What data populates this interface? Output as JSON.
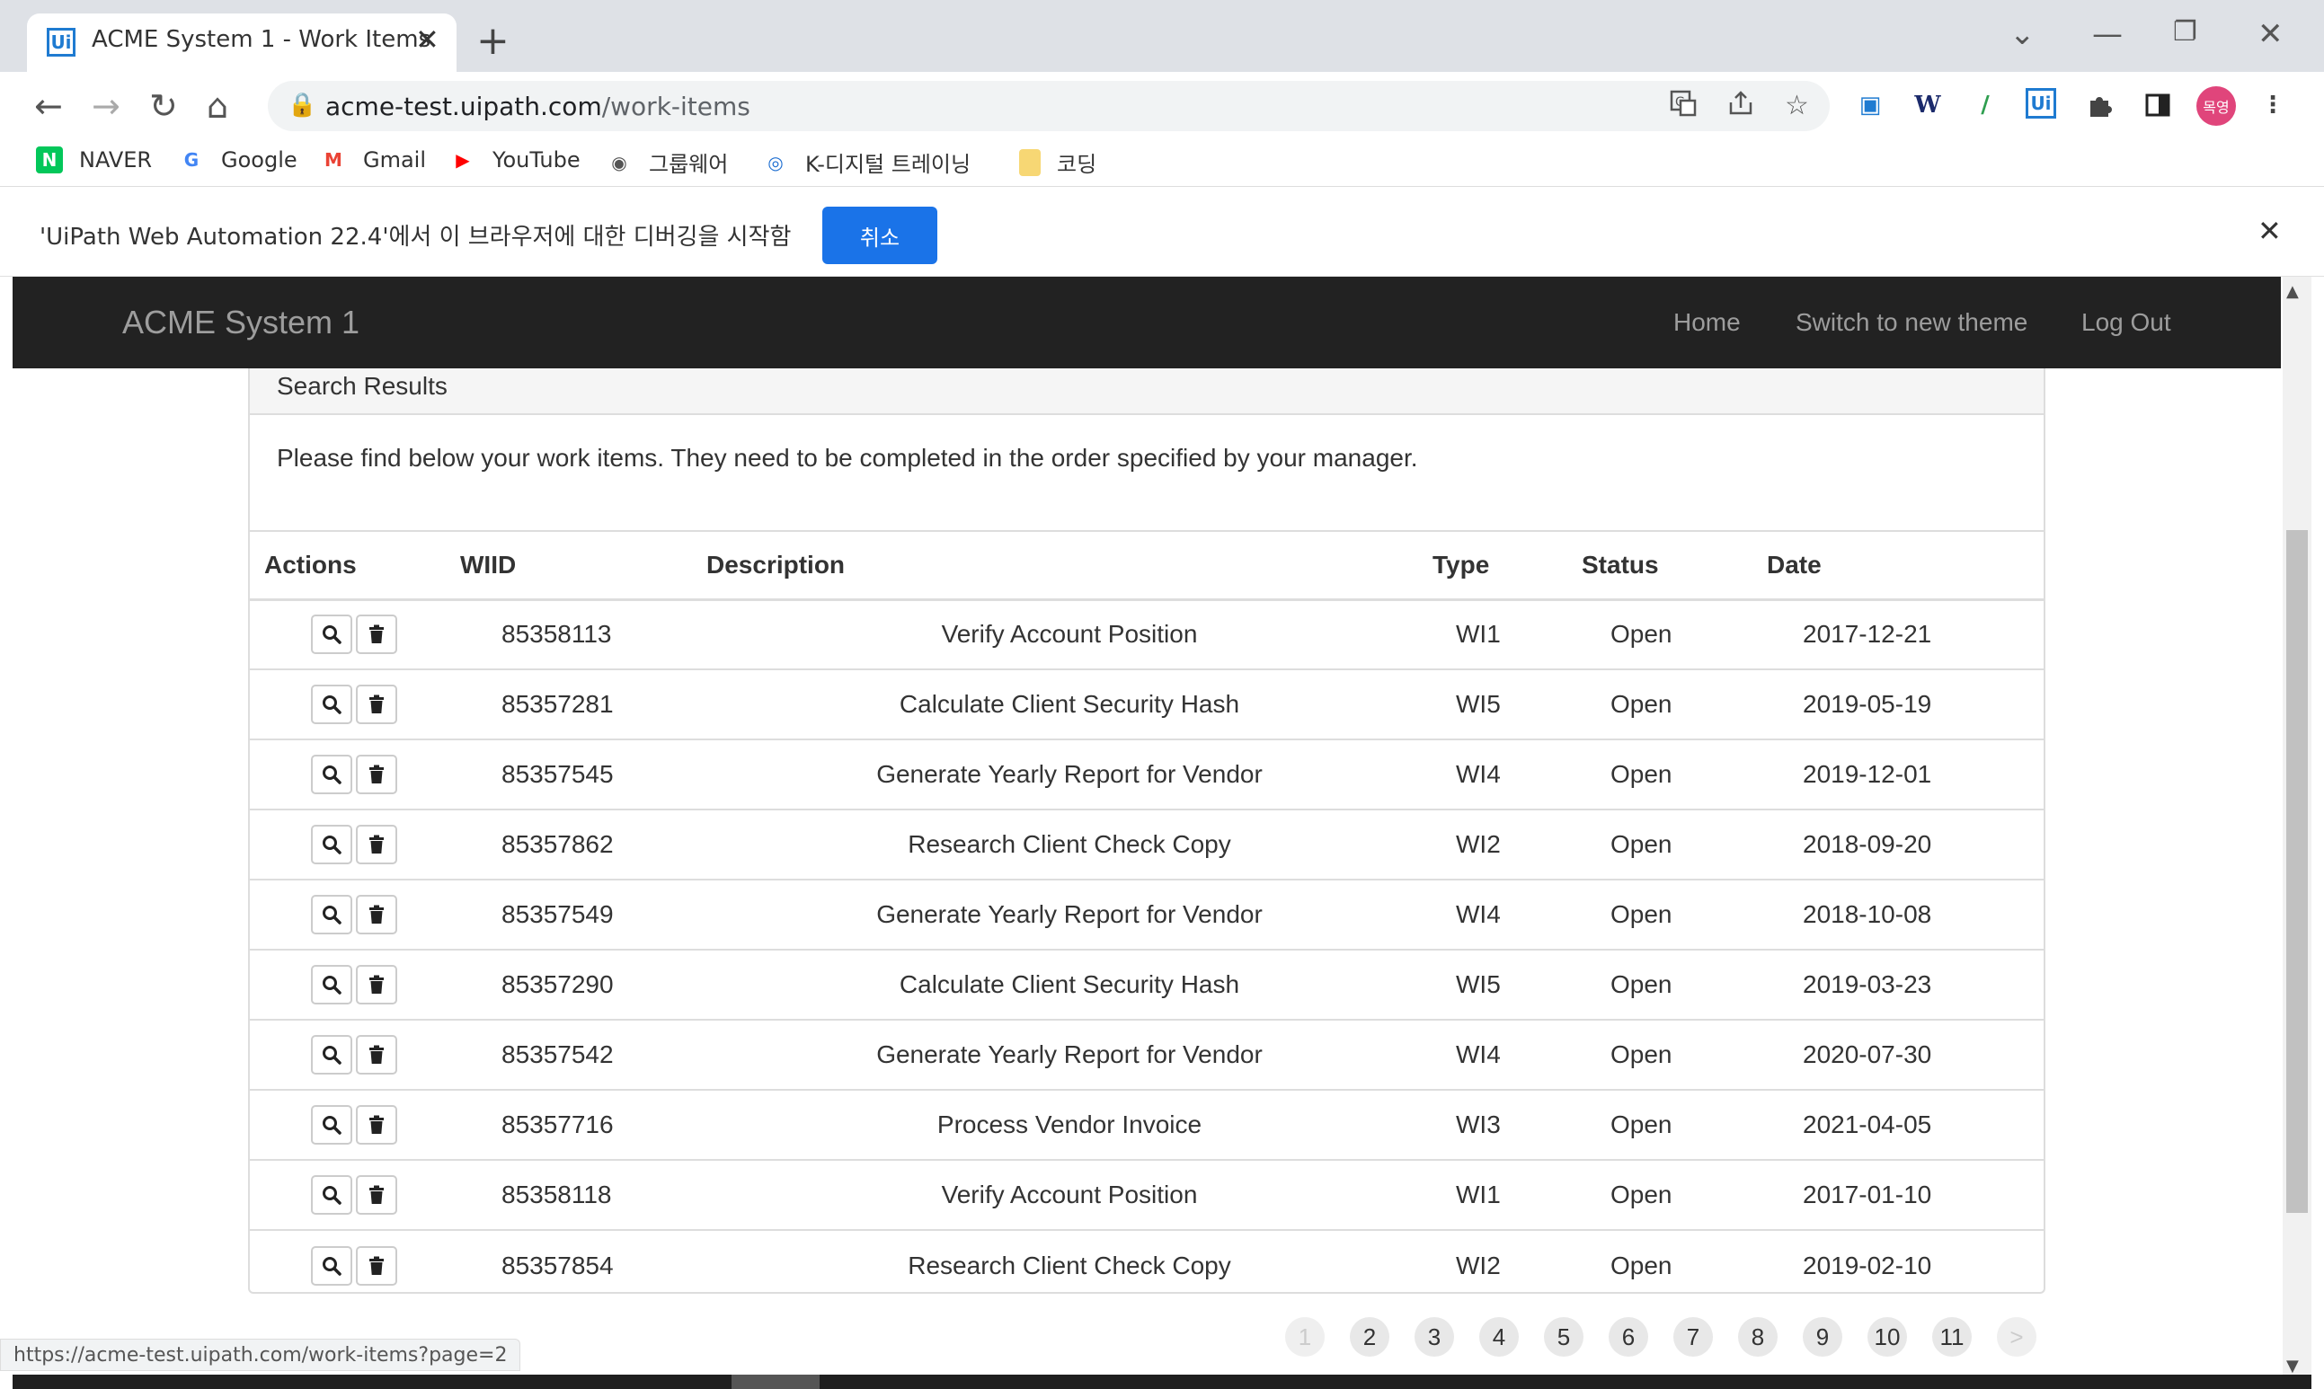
{
  "browser": {
    "tab_title": "ACME System 1 - Work Items",
    "tab_favicon": "Ui",
    "tab_close": "✕",
    "new_tab": "+",
    "url_host": "acme-test.uipath.com",
    "url_path": "/work-items",
    "window": {
      "tabsearch": "⌄",
      "minimize": "—",
      "restore": "❐",
      "close": "✕"
    },
    "nav": {
      "back": "←",
      "forward": "→",
      "reload": "↻",
      "home": "⌂"
    },
    "profile_label": "목영",
    "bookmarks": [
      {
        "label": "NAVER",
        "icon": "naver-icon",
        "glyph": "N",
        "color": "#03c75a"
      },
      {
        "label": "Google",
        "icon": "google-icon",
        "glyph": "G",
        "color": "#4285f4"
      },
      {
        "label": "Gmail",
        "icon": "gmail-icon",
        "glyph": "M",
        "color": "#ea4335"
      },
      {
        "label": "YouTube",
        "icon": "youtube-icon",
        "glyph": "▶",
        "color": "#ff0000"
      },
      {
        "label": "그룹웨어",
        "icon": "globe-icon",
        "glyph": "◉",
        "color": "#555555"
      },
      {
        "label": "K-디지털 트레이닝",
        "icon": "kdt-icon",
        "glyph": "◎",
        "color": "#1f6fd1"
      },
      {
        "label": "코딩",
        "icon": "folder-icon",
        "glyph": "",
        "color": "#f7d774"
      }
    ]
  },
  "infobar": {
    "message": "'UiPath Web Automation 22.4'에서 이 브라우저에 대한 디버깅을 시작함",
    "cancel_label": "취소",
    "close": "✕"
  },
  "app": {
    "brand": "ACME System 1",
    "nav": {
      "home": "Home",
      "switch_theme": "Switch to new theme",
      "logout": "Log Out"
    }
  },
  "panel": {
    "title": "Search Results",
    "intro": "Please find below your work items. They need to be completed in the order specified by your manager."
  },
  "table": {
    "headers": {
      "actions": "Actions",
      "wiid": "WIID",
      "description": "Description",
      "type": "Type",
      "status": "Status",
      "date": "Date"
    },
    "rows": [
      {
        "wiid": "85358113",
        "description": "Verify Account Position",
        "type": "WI1",
        "status": "Open",
        "date": "2017-12-21"
      },
      {
        "wiid": "85357281",
        "description": "Calculate Client Security Hash",
        "type": "WI5",
        "status": "Open",
        "date": "2019-05-19"
      },
      {
        "wiid": "85357545",
        "description": "Generate Yearly Report for Vendor",
        "type": "WI4",
        "status": "Open",
        "date": "2019-12-01"
      },
      {
        "wiid": "85357862",
        "description": "Research Client Check Copy",
        "type": "WI2",
        "status": "Open",
        "date": "2018-09-20"
      },
      {
        "wiid": "85357549",
        "description": "Generate Yearly Report for Vendor",
        "type": "WI4",
        "status": "Open",
        "date": "2018-10-08"
      },
      {
        "wiid": "85357290",
        "description": "Calculate Client Security Hash",
        "type": "WI5",
        "status": "Open",
        "date": "2019-03-23"
      },
      {
        "wiid": "85357542",
        "description": "Generate Yearly Report for Vendor",
        "type": "WI4",
        "status": "Open",
        "date": "2020-07-30"
      },
      {
        "wiid": "85357716",
        "description": "Process Vendor Invoice",
        "type": "WI3",
        "status": "Open",
        "date": "2021-04-05"
      },
      {
        "wiid": "85358118",
        "description": "Verify Account Position",
        "type": "WI1",
        "status": "Open",
        "date": "2017-01-10"
      },
      {
        "wiid": "85357854",
        "description": "Research Client Check Copy",
        "type": "WI2",
        "status": "Open",
        "date": "2019-02-10"
      }
    ]
  },
  "pagination": {
    "pages": [
      "1",
      "2",
      "3",
      "4",
      "5",
      "6",
      "7",
      "8",
      "9",
      "10",
      "11"
    ],
    "current": "1",
    "next": ">"
  },
  "status_url": "https://acme-test.uipath.com/work-items?page=2",
  "colors": {
    "navbar": "#222222",
    "infobar_button": "#1a73e8",
    "profile": "#e0457b"
  }
}
